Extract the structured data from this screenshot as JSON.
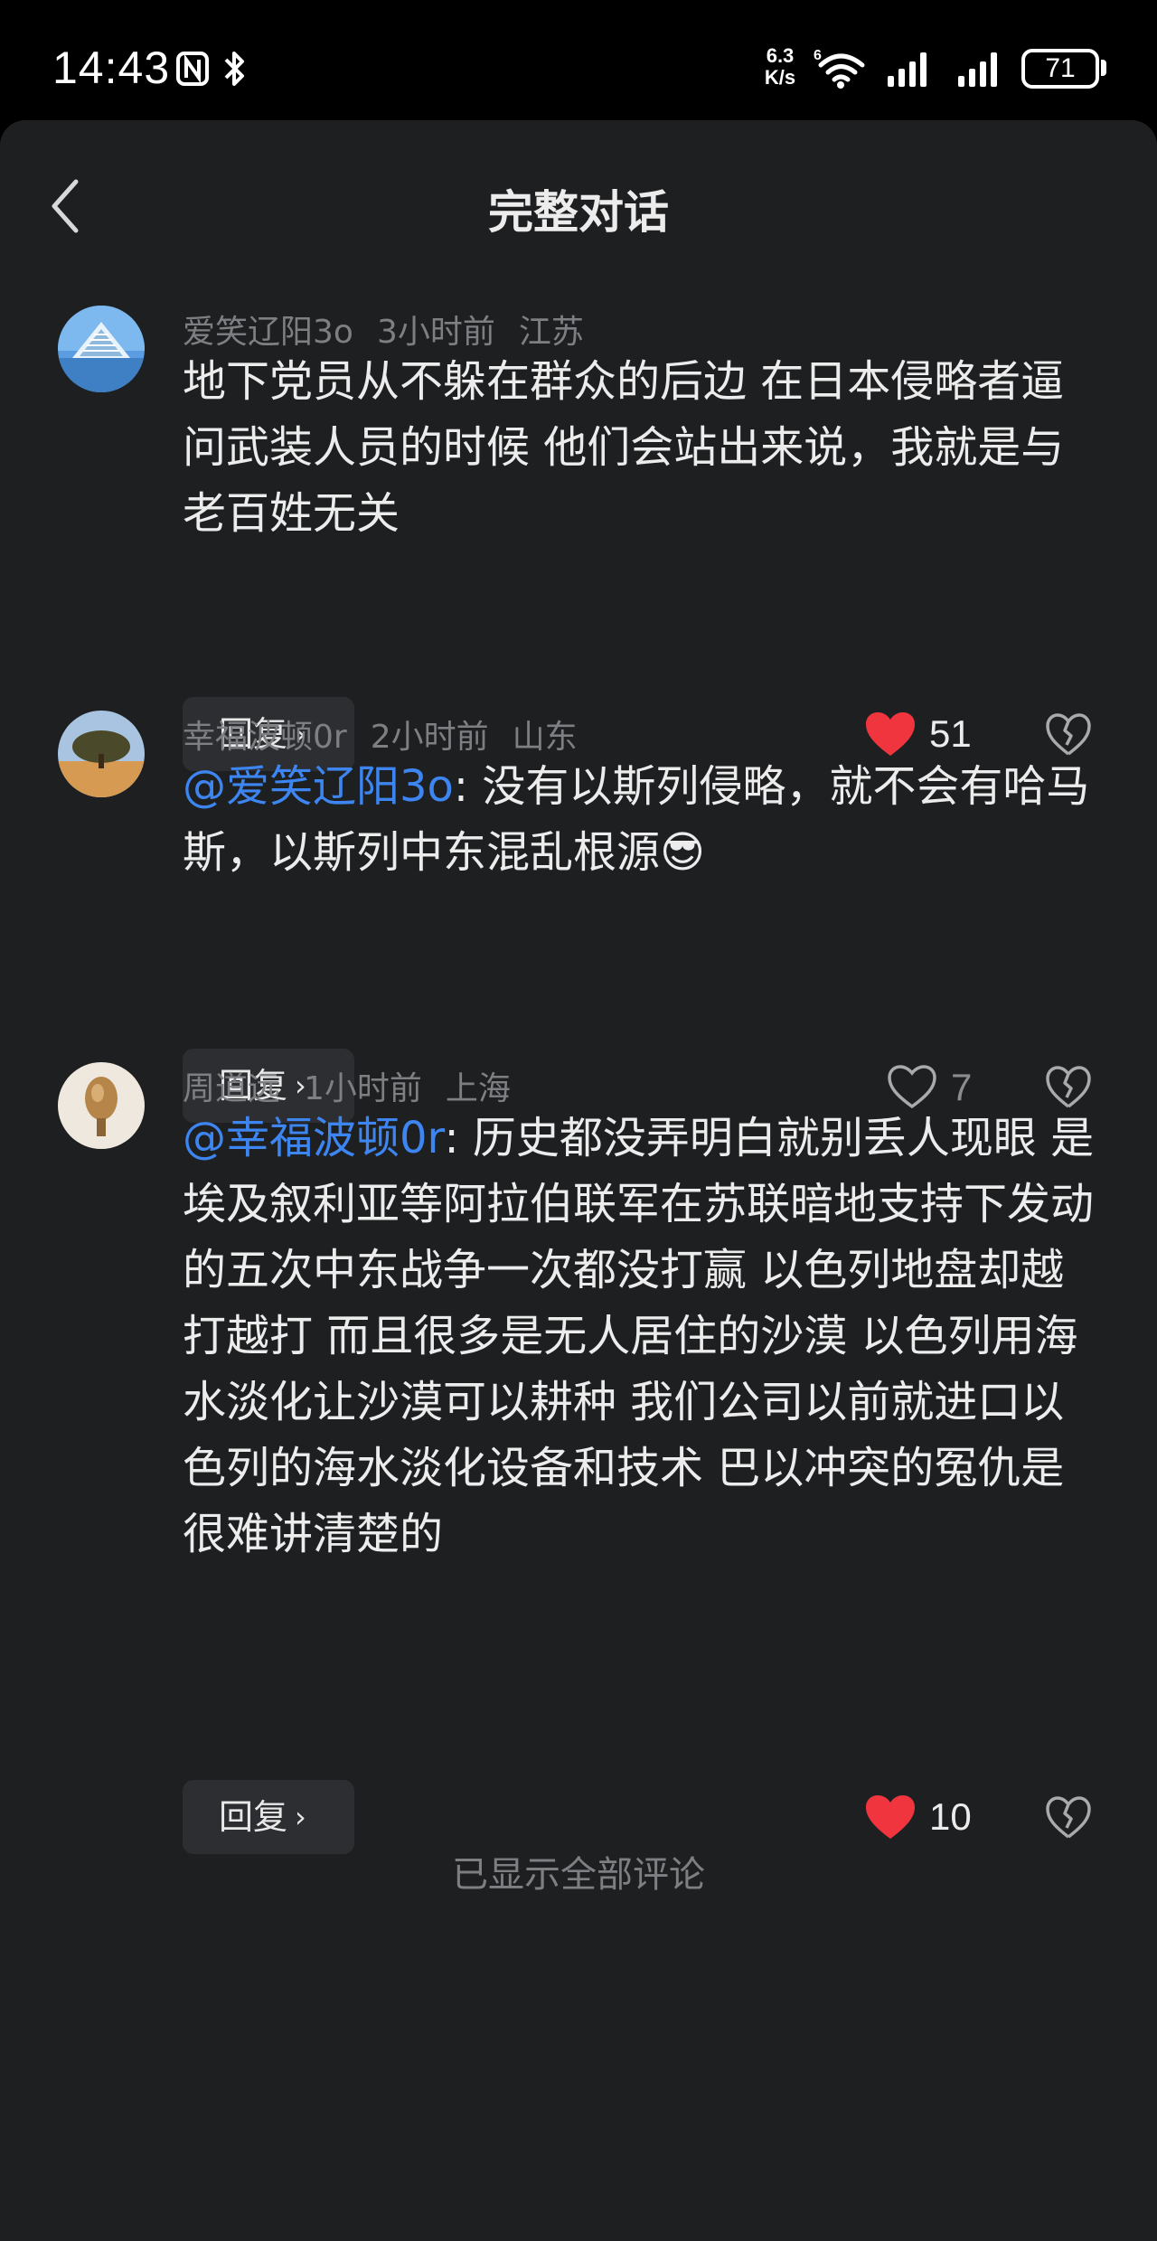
{
  "status_bar": {
    "time": "14:43",
    "net_speed_value": "6.3",
    "net_speed_unit": "K/s",
    "battery": "71"
  },
  "header": {
    "title": "完整对话"
  },
  "comments": [
    {
      "author": "爱笑辽阳3o",
      "time": "3小时前",
      "location": "江苏",
      "mention": "",
      "text": "地下党员从不躲在群众的后边 在日本侵略者逼问武装人员的时候 他们会站出来说，我就是与老百姓无关",
      "reply_label": "回复",
      "likes": "51",
      "liked": true
    },
    {
      "author": "幸福波顿0r",
      "time": "2小时前",
      "location": "山东",
      "mention": "@爱笑辽阳3o",
      "text": ": 没有以斯列侵略，就不会有哈马斯，以斯列中东混乱根源😎",
      "reply_label": "回复",
      "likes": "7",
      "liked": false
    },
    {
      "author": "周道远",
      "time": "1小时前",
      "location": "上海",
      "mention": "@幸福波顿0r",
      "text": ": 历史都没弄明白就别丢人现眼 是埃及叙利亚等阿拉伯联军在苏联暗地支持下发动的五次中东战争一次都没打赢 以色列地盘却越打越打 而且很多是无人居住的沙漠 以色列用海水淡化让沙漠可以耕种 我们公司以前就进口以色列的海水淡化设备和技术 巴以冲突的冤仇是很难讲清楚的",
      "reply_label": "回复",
      "likes": "10",
      "liked": true
    }
  ],
  "footer": {
    "text": "已显示全部评论"
  },
  "colors": {
    "background": "#1e1f21",
    "mention": "#3d86f2",
    "like_active": "#f0353f",
    "reply_bg": "#2d2e31"
  }
}
